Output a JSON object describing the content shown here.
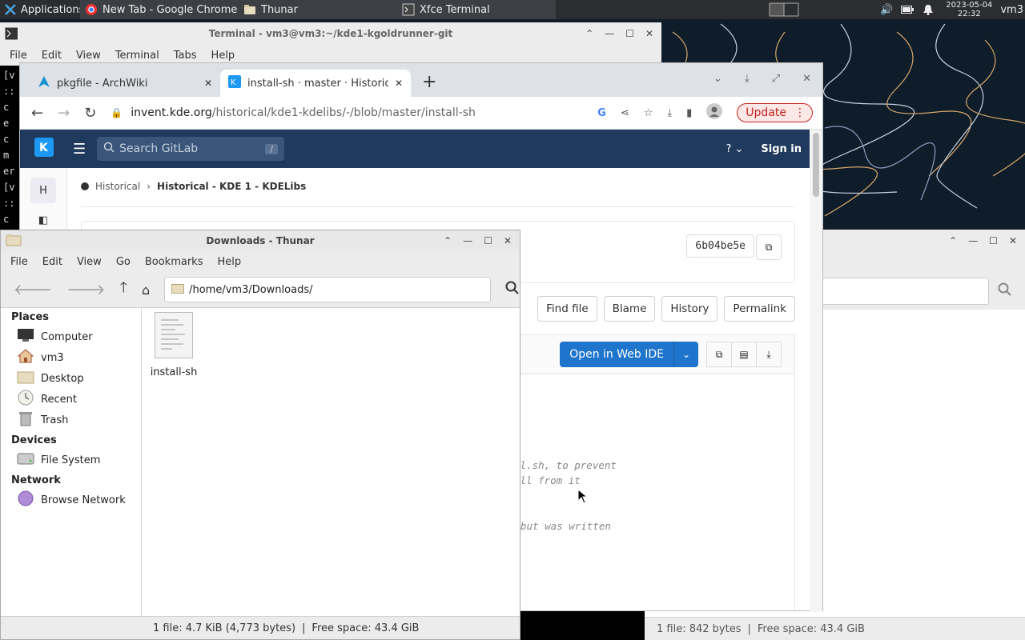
{
  "panel": {
    "applications_label": "Applications",
    "tasks": [
      {
        "label": "New Tab - Google Chrome"
      },
      {
        "label": "Thunar"
      },
      {
        "label": "Xfce Terminal"
      }
    ],
    "date": "2023-05-04",
    "time": "22:32",
    "user": "vm3"
  },
  "terminal": {
    "title": "Terminal - vm3@vm3:~/kde1-kgoldrunner-git",
    "menu": [
      "File",
      "Edit",
      "View",
      "Terminal",
      "Tabs",
      "Help"
    ],
    "left_glyphs": [
      "[v",
      "::",
      "c",
      "e",
      "c",
      "m",
      "er",
      "[v",
      "::",
      "c",
      "c"
    ]
  },
  "chrome": {
    "tabs": [
      {
        "label": "pkgfile - ArchWiki"
      },
      {
        "label": "install-sh · master · Historical /"
      }
    ],
    "url_host": "invent.kde.org",
    "url_path": "/historical/kde1-kdelibs/-/blob/master/install-sh",
    "update_label": "Update",
    "gitlab": {
      "search_placeholder": "Search GitLab",
      "search_shortcut": "/",
      "sign_in": "Sign in",
      "sidebar_letter": "H",
      "breadcrumb_1": "Historical",
      "breadcrumb_2": "Historical - KDE 1 - KDELibs",
      "commit_sha": "6b04be5e",
      "buttons": [
        "Find file",
        "Blame",
        "History",
        "Permalink"
      ],
      "open_ide": "Open in Web IDE",
      "code_lines": [
        {
          "text": "ll.sh, to prevent"
        },
        {
          "text": "all from it"
        },
        {
          "text": "but was written"
        }
      ]
    }
  },
  "thunar": {
    "title": "Downloads - Thunar",
    "menu": [
      "File",
      "Edit",
      "View",
      "Go",
      "Bookmarks",
      "Help"
    ],
    "path": "/home/vm3/Downloads/",
    "places_head": "Places",
    "places": [
      "Computer",
      "vm3",
      "Desktop",
      "Recent",
      "Trash"
    ],
    "devices_head": "Devices",
    "devices": [
      "File System"
    ],
    "network_head": "Network",
    "network": [
      "Browse Network"
    ],
    "file_name": "install-sh",
    "status_file": "1 file: 4.7 KiB (4,773 bytes)",
    "status_sep": "|",
    "status_free": "Free space: 43.4 GiB"
  },
  "thunar2": {
    "status_file": "1 file: 842 bytes",
    "status_sep": "|",
    "status_free": "Free space: 43.4 GiB"
  }
}
